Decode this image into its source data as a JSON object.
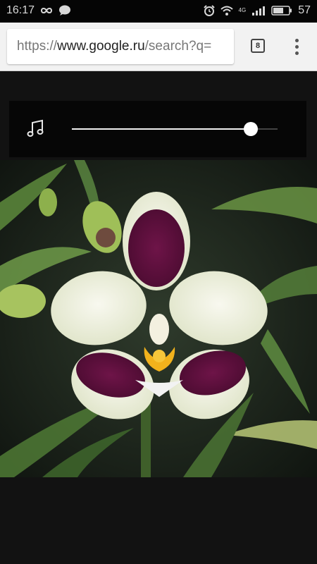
{
  "status_bar": {
    "time": "16:17",
    "network_label": "4G",
    "battery": "57"
  },
  "browser": {
    "url_prefix": "https://",
    "url_host": "www.google.ru",
    "url_path": "/search?q=",
    "tab_count": "8"
  },
  "audio_player": {
    "icon": "music-note-icon",
    "progress_fraction": 0.87
  },
  "media": {
    "image": "orchid-photo",
    "subject": "white and purple phalaenopsis orchid"
  },
  "colors": {
    "status_bar_bg": "#050505",
    "toolbar_bg": "#f2f2f2",
    "page_bg": "#121212",
    "player_bg": "#060606"
  }
}
